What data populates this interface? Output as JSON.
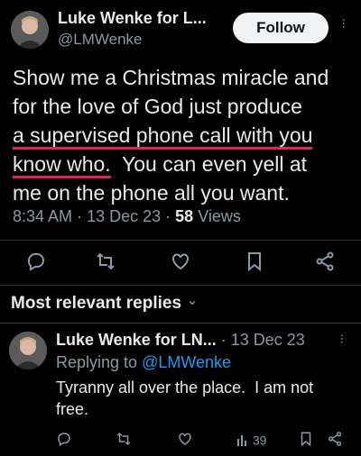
{
  "tweet": {
    "author_name": "Luke Wenke for L...",
    "author_handle": "@LMWenke",
    "follow_label": "Follow",
    "text_lines": [
      "Show me a Christmas miracle and",
      "for the love of God just produce",
      "a supervised phone call with you",
      "know who.",
      "  You can even yell at",
      "me on the phone all you want."
    ],
    "time": "8:34 AM",
    "date": "13 Dec 23",
    "views_count": "58",
    "views_label": "Views",
    "separator": "·"
  },
  "actions": {
    "icons": [
      "reply-icon",
      "retweet-icon",
      "like-icon",
      "bookmark-icon",
      "share-icon"
    ]
  },
  "replies_section": {
    "heading": "Most relevant replies",
    "chevron": "⌄"
  },
  "reply": {
    "author_name": "Luke Wenke for LN...",
    "date": "· 13 Dec 23",
    "replying_prefix": "Replying to",
    "replying_handle": "@LMWenke",
    "text_line1": "Tyranny all over the place.  I am not",
    "text_line2": "free.",
    "views_count": "39"
  },
  "colors": {
    "background": "#000000",
    "text": "#e7e9ea",
    "muted": "#8b98a5",
    "link": "#1d9bf0",
    "underline": "#e0245e"
  }
}
